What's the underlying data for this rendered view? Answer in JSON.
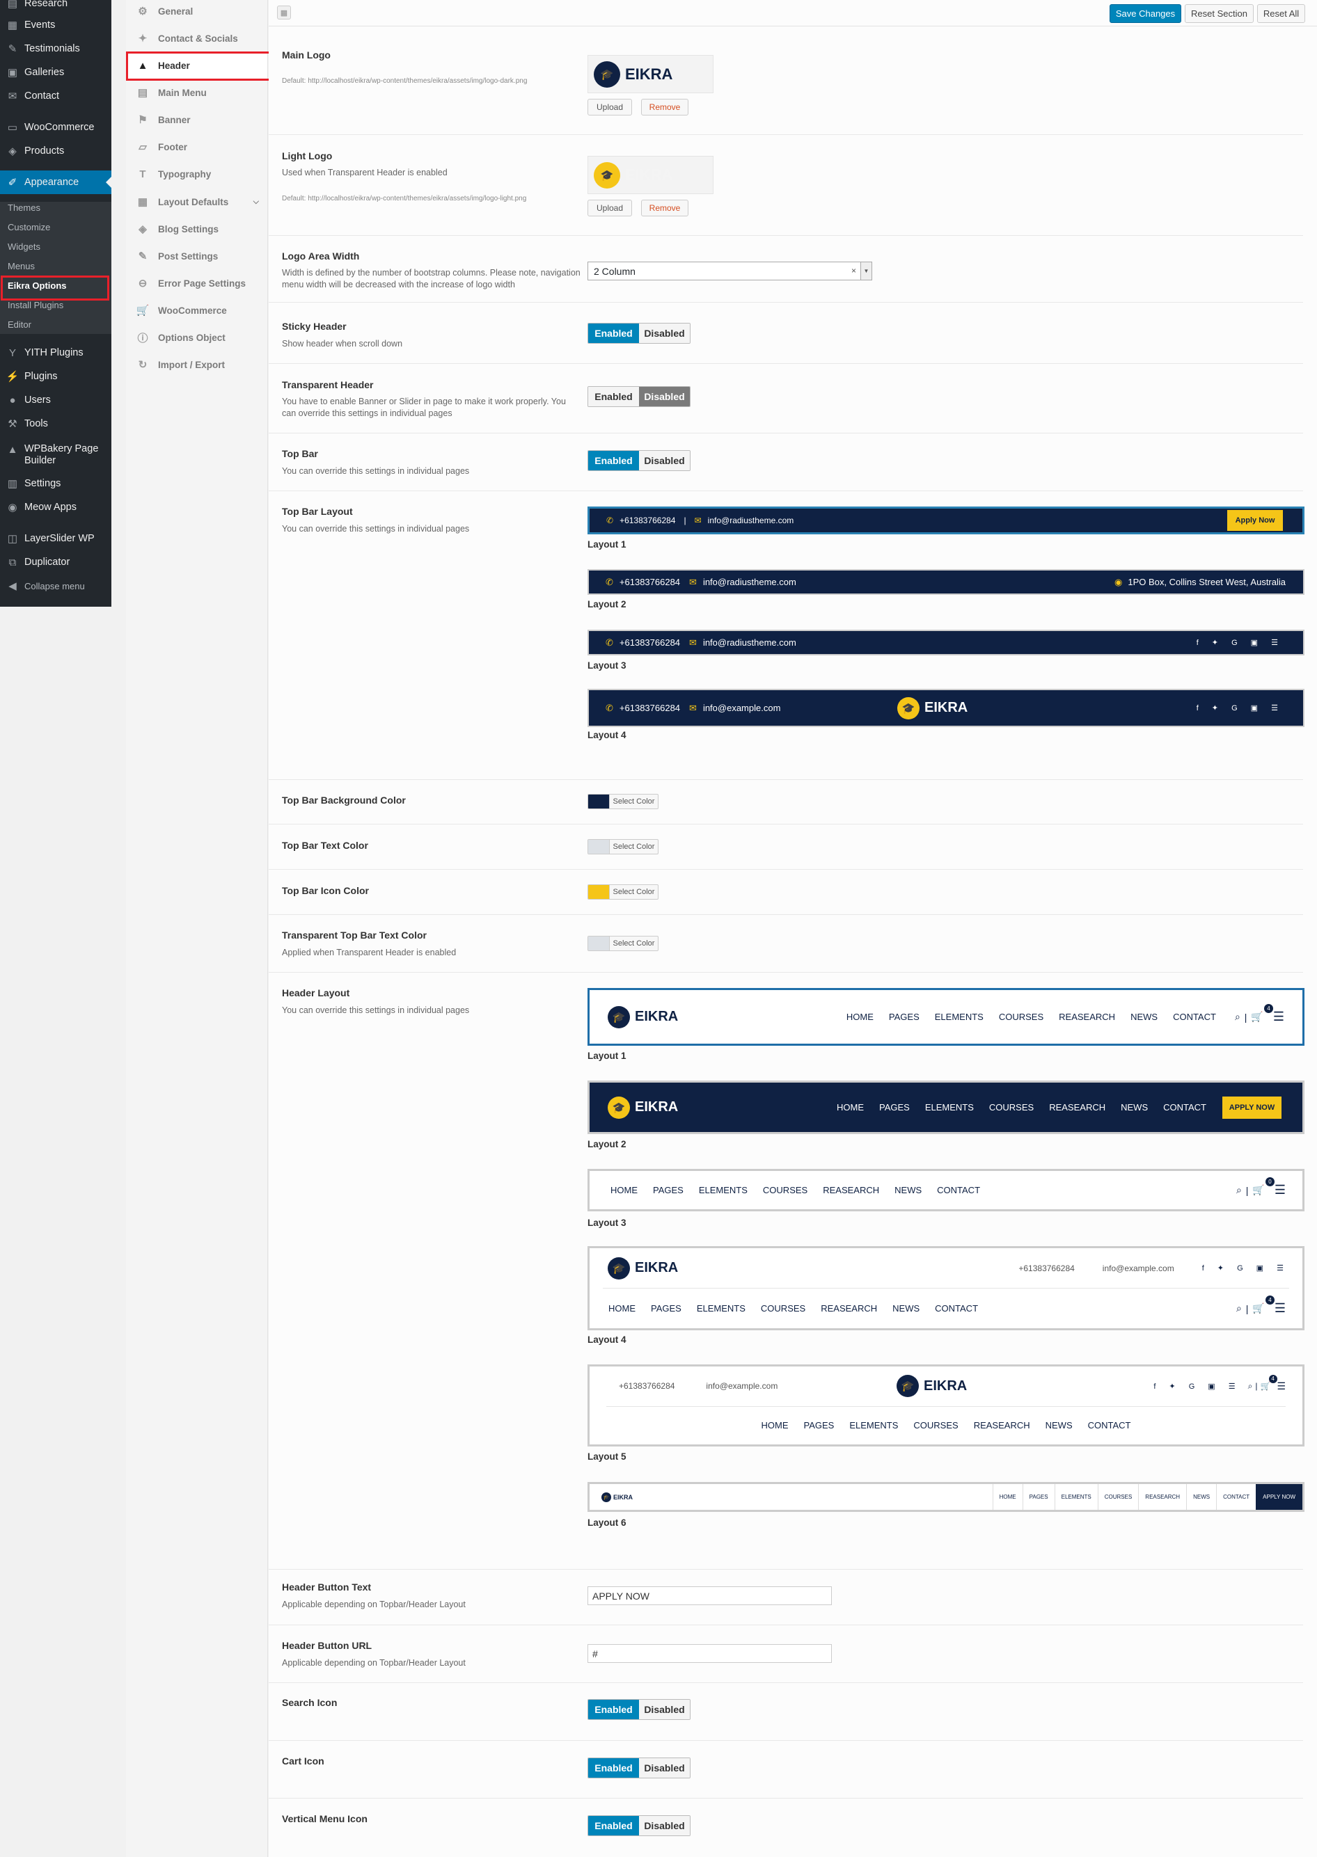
{
  "wp_menu": [
    {
      "label": "Research",
      "icon": "clipboard-icon"
    },
    {
      "label": "Events",
      "icon": "calendar-icon"
    },
    {
      "label": "Testimonials",
      "icon": "testimonial-icon"
    },
    {
      "label": "Galleries",
      "icon": "gallery-icon"
    },
    {
      "label": "Contact",
      "icon": "mail-icon"
    },
    {
      "label": "WooCommerce",
      "icon": "woocommerce-icon"
    },
    {
      "label": "Products",
      "icon": "products-icon"
    },
    {
      "label": "Appearance",
      "icon": "paintbrush-icon"
    },
    {
      "label": "YITH Plugins",
      "icon": "yith-icon"
    },
    {
      "label": "Plugins",
      "icon": "plugin-icon"
    },
    {
      "label": "Users",
      "icon": "users-icon"
    },
    {
      "label": "Tools",
      "icon": "wrench-icon"
    },
    {
      "label": "WPBakery Page Builder",
      "icon": "wpbakery-icon"
    },
    {
      "label": "Settings",
      "icon": "settings-icon"
    },
    {
      "label": "Meow Apps",
      "icon": "meow-icon"
    },
    {
      "label": "LayerSlider WP",
      "icon": "layerslider-icon"
    },
    {
      "label": "Duplicator",
      "icon": "duplicator-icon"
    },
    {
      "label": "Collapse menu",
      "icon": "collapse-icon"
    }
  ],
  "wp_submenu": [
    "Themes",
    "Customize",
    "Widgets",
    "Menus",
    "Eikra Options",
    "Install Plugins",
    "Editor"
  ],
  "opt_nav": [
    {
      "label": "General",
      "icon": "general-icon"
    },
    {
      "label": "Contact & Socials",
      "icon": "twitter-icon"
    },
    {
      "label": "Header",
      "icon": "header-icon"
    },
    {
      "label": "Main Menu",
      "icon": "menu-icon"
    },
    {
      "label": "Banner",
      "icon": "flag-icon"
    },
    {
      "label": "Footer",
      "icon": "footer-icon"
    },
    {
      "label": "Typography",
      "icon": "typography-icon"
    },
    {
      "label": "Layout Defaults",
      "icon": "grid-icon"
    },
    {
      "label": "Blog Settings",
      "icon": "tags-icon"
    },
    {
      "label": "Post Settings",
      "icon": "edit-icon"
    },
    {
      "label": "Error Page Settings",
      "icon": "minus-circle-icon"
    },
    {
      "label": "WooCommerce",
      "icon": "cart-icon"
    },
    {
      "label": "Options Object",
      "icon": "info-icon"
    },
    {
      "label": "Import / Export",
      "icon": "refresh-icon"
    }
  ],
  "toolbar": {
    "save": "Save Changes",
    "reset_section": "Reset Section",
    "reset_all": "Reset All"
  },
  "fields": {
    "main_logo": {
      "label": "Main Logo",
      "desc": "Default: http://localhost/eikra/wp-content/themes/eikra/assets/img/logo-dark.png"
    },
    "light_logo": {
      "label": "Light Logo",
      "desc": "Used when Transparent Header is enabled",
      "desc2": "Default: http://localhost/eikra/wp-content/themes/eikra/assets/img/logo-light.png"
    },
    "upload": "Upload",
    "remove": "Remove",
    "logo_width": {
      "label": "Logo Area Width",
      "desc": "Width is defined by the number of bootstrap columns. Please note, navigation menu width will be decreased with the increase of logo width",
      "value": "2 Column",
      "clear": "×",
      "arrow": "▼"
    },
    "sticky": {
      "label": "Sticky Header",
      "desc": "Show header when scroll down"
    },
    "transparent": {
      "label": "Transparent Header",
      "desc": "You have to enable Banner or Slider in page to make it work properly. You can override this settings in individual pages"
    },
    "top_bar": {
      "label": "Top Bar",
      "desc": "You can override this settings in individual pages"
    },
    "top_bar_layout": {
      "label": "Top Bar Layout",
      "desc": "You can override this settings in individual pages"
    },
    "tb_bg": {
      "label": "Top Bar Background Color",
      "color": "#0f2143"
    },
    "tb_text": {
      "label": "Top Bar Text Color",
      "color": "#dde1e6"
    },
    "tb_icon": {
      "label": "Top Bar Icon Color",
      "color": "#f5c518"
    },
    "tr_text": {
      "label": "Transparent Top Bar Text Color",
      "desc": "Applied when Transparent Header is enabled",
      "color": "#dde1e6"
    },
    "header_layout": {
      "label": "Header Layout",
      "desc": "You can override this settings in individual pages"
    },
    "btn_text": {
      "label": "Header Button Text",
      "desc": "Applicable depending on Topbar/Header Layout",
      "value": "APPLY NOW"
    },
    "btn_url": {
      "label": "Header Button URL",
      "desc": "Applicable depending on Topbar/Header Layout",
      "value": "#"
    },
    "search_icon": {
      "label": "Search Icon"
    },
    "cart_icon": {
      "label": "Cart Icon"
    },
    "vmenu_icon": {
      "label": "Vertical Menu Icon"
    }
  },
  "toggle": {
    "enabled": "Enabled",
    "disabled": "Disabled"
  },
  "select_color": "Select Color",
  "brand": "EIKRA",
  "phone": "+61383766284",
  "email1": "info@radiustheme.com",
  "email2": "info@example.com",
  "address": "1PO Box, Collins Street West, Australia",
  "apply_now_tb": "Apply Now",
  "apply_now": "APPLY NOW",
  "nav": [
    "HOME",
    "PAGES",
    "ELEMENTS",
    "COURSES",
    "REASEARCH",
    "NEWS",
    "CONTACT"
  ],
  "cart_count_a": "4",
  "cart_count_b": "0",
  "tb_layouts": [
    "Layout 1",
    "Layout 2",
    "Layout 3",
    "Layout 4"
  ],
  "hd_layouts": [
    "Layout 1",
    "Layout 2",
    "Layout 3",
    "Layout 4",
    "Layout 5",
    "Layout 6"
  ],
  "colors": {
    "accent": "#0085ba",
    "navy": "#0f2143",
    "yellow": "#f5c518",
    "highlight": "#e8202a"
  }
}
